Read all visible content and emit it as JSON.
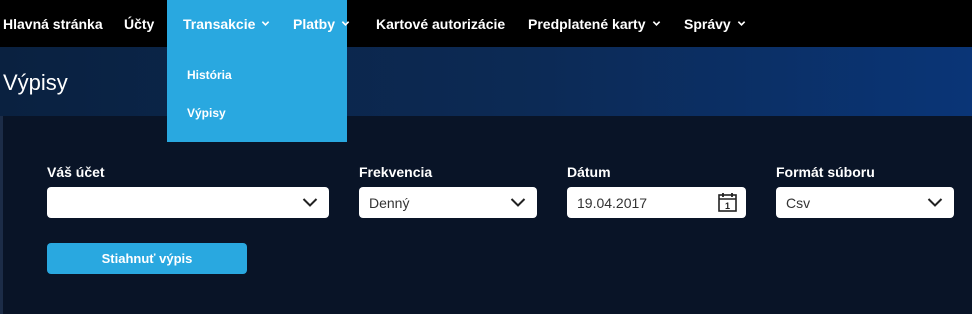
{
  "nav": {
    "items": [
      {
        "label": "Hlavná stránka",
        "has_dropdown": false
      },
      {
        "label": "Účty",
        "has_dropdown": false
      },
      {
        "label": "Transakcie",
        "has_dropdown": true,
        "active": true
      },
      {
        "label": "Platby",
        "has_dropdown": true
      },
      {
        "label": "Kartové autorizácie",
        "has_dropdown": false
      },
      {
        "label": "Predplatené karty",
        "has_dropdown": true
      },
      {
        "label": "Správy",
        "has_dropdown": true
      }
    ],
    "dropdown": {
      "items": [
        {
          "label": "História"
        },
        {
          "label": "Výpisy"
        }
      ]
    }
  },
  "page": {
    "title": "Výpisy"
  },
  "form": {
    "account": {
      "label": "Váš účet",
      "value": ""
    },
    "frequency": {
      "label": "Frekvencia",
      "value": "Denný"
    },
    "date": {
      "label": "Dátum",
      "value": "19.04.2017",
      "icon": "calendar-icon"
    },
    "format": {
      "label": "Formát súboru",
      "value": "Csv"
    },
    "download_label": "Stiahnuť výpis"
  },
  "colors": {
    "accent": "#29a8e0",
    "nav_bg": "#000000",
    "page_bg": "#091427"
  }
}
